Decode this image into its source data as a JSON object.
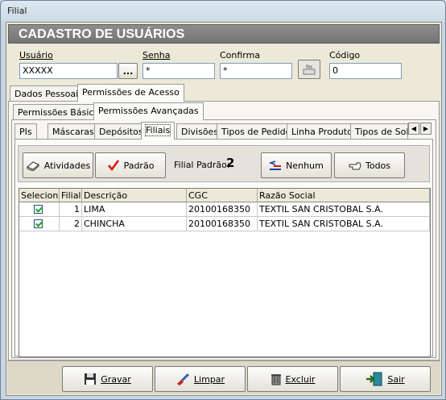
{
  "window": {
    "title": "Filial"
  },
  "header": {
    "title": "CADASTRO DE USUÁRIOS"
  },
  "fields": {
    "usuario": {
      "label": "Usuário",
      "value": "XXXXX",
      "lookup_label": "..."
    },
    "senha": {
      "label": "Senha",
      "value": "*"
    },
    "confirma": {
      "label": "Confirma",
      "value": "*"
    },
    "codigo": {
      "label": "Código",
      "value": "0"
    }
  },
  "main_tabs": [
    "Dados Pessoais",
    "Permissões de Acesso"
  ],
  "perm_tabs": [
    "Permissões Básicas",
    "Permissões Avançadas"
  ],
  "adv_tabs": [
    "PIs",
    "Máscaras",
    "Depósitos",
    "Filiais",
    "Divisões",
    "Tipos de Pedido",
    "Linha Produto",
    "Tipos de Solic"
  ],
  "toolbar": {
    "atividades": "Atividades",
    "padrao": "Padrão",
    "filial_padrao_label": "Filial Padrão:",
    "filial_padrao_value": "2",
    "nenhum": "Nenhum",
    "todos": "Todos"
  },
  "grid": {
    "columns": [
      "Seleciona",
      "Filial",
      "Descrição",
      "CGC",
      "Razão Social"
    ],
    "rows": [
      {
        "selected": true,
        "filial": "1",
        "descricao": "LIMA",
        "cgc": "20100168350",
        "razao": "TEXTIL SAN CRISTOBAL S.A."
      },
      {
        "selected": true,
        "filial": "2",
        "descricao": "CHINCHA",
        "cgc": "20100168350",
        "razao": "TEXTIL SAN CRISTOBAL S.A."
      }
    ]
  },
  "footer": {
    "gravar": "Gravar",
    "limpar": "Limpar",
    "excluir": "Excluir",
    "sair": "Sair"
  }
}
